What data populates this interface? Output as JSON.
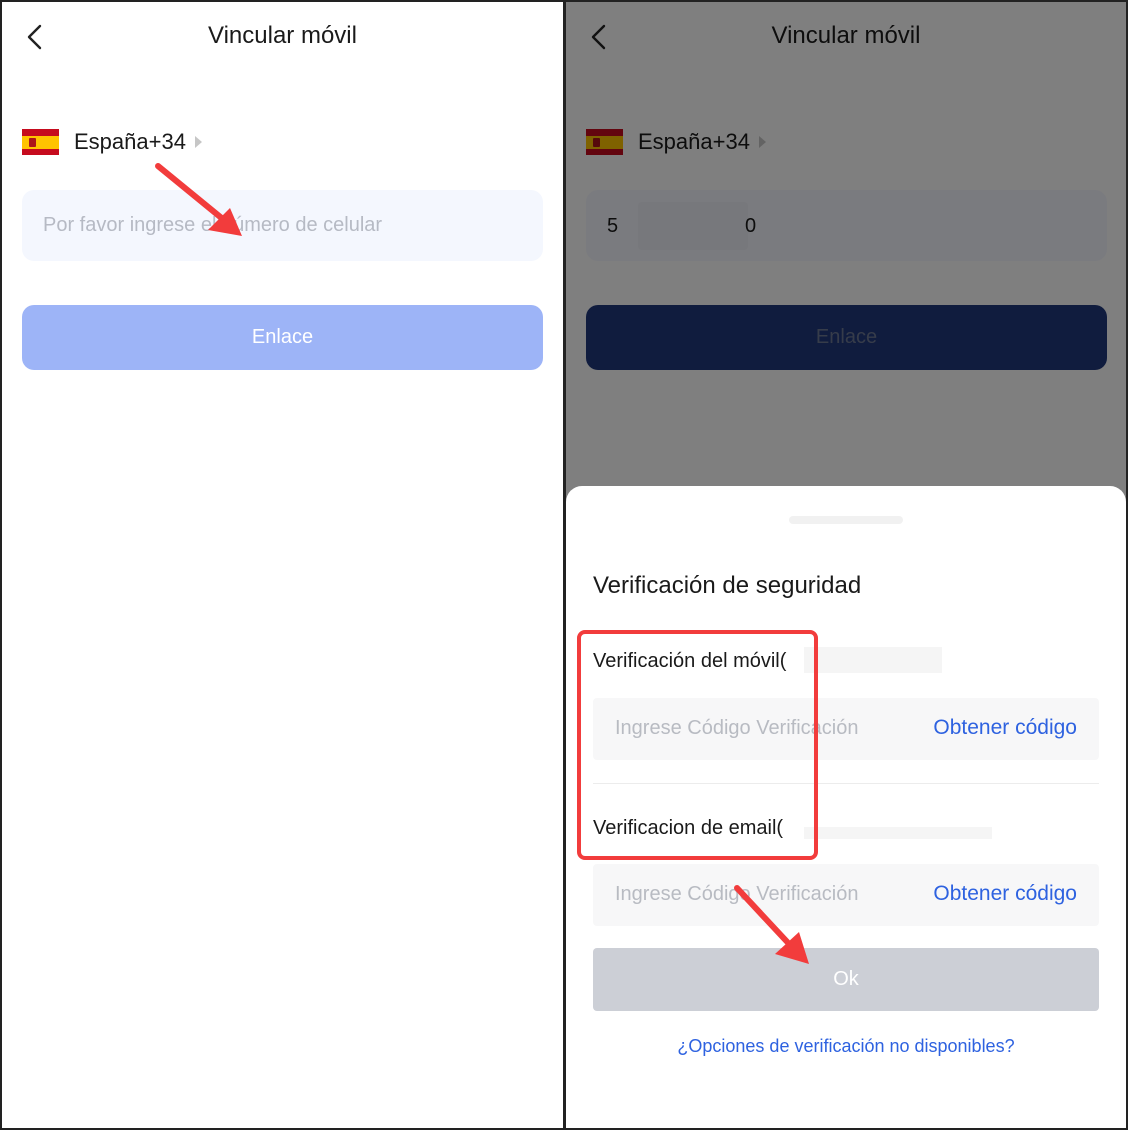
{
  "left_screen": {
    "nav": {
      "title": "Vincular móvil",
      "back_icon": "chevron-left-icon"
    },
    "country": {
      "label": "España+34",
      "flag": "spain-flag-icon"
    },
    "phone_input": {
      "placeholder": "Por favor ingrese el número de celular",
      "value": ""
    },
    "submit_button": {
      "label": "Enlace"
    }
  },
  "right_screen": {
    "nav": {
      "title": "Vincular móvil",
      "back_icon": "chevron-left-icon"
    },
    "country": {
      "label": "España+34",
      "flag": "spain-flag-icon"
    },
    "phone_input": {
      "value_start": "5",
      "value_end": "0"
    },
    "submit_button": {
      "label": "Enlace"
    },
    "sheet": {
      "title": "Verificación de seguridad",
      "mobile": {
        "label": "Verificación del móvil(",
        "placeholder": "Ingrese Código Verificación",
        "action": "Obtener código"
      },
      "email": {
        "label": "Verificacion de email(",
        "placeholder": "Ingrese Código Verificación",
        "action": "Obtener código"
      },
      "ok_button": {
        "label": "Ok"
      },
      "alt_link": "¿Opciones de verificación no disponibles?"
    }
  },
  "colors": {
    "primary_disabled": "#9db4f7",
    "primary_dark": "#21387c",
    "link_blue": "#2e62e0",
    "annotation_red": "#f23c3c",
    "input_bg": "#f4f7fe"
  }
}
